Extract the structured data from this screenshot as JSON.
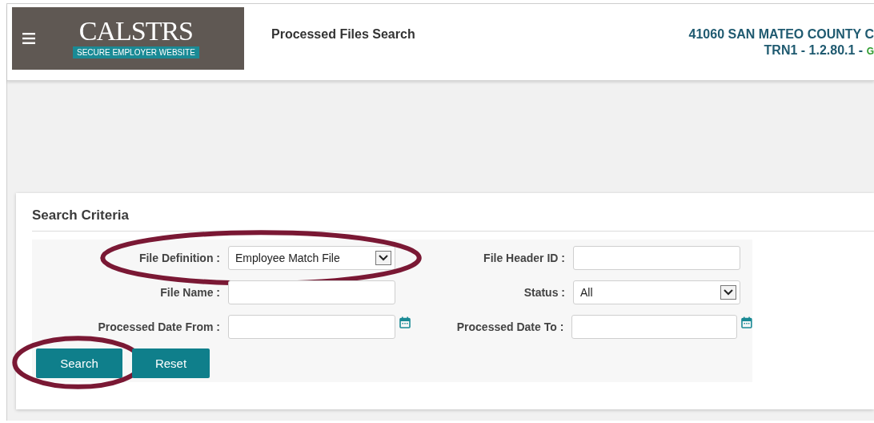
{
  "header": {
    "logo": {
      "name": "CALSTRS",
      "tagline": "SECURE EMPLOYER WEBSITE"
    },
    "page_title": "Processed Files Search",
    "employer": "41060 SAN MATEO COUNTY C",
    "environment": "TRN1 - 1.2.80.1 -",
    "status": "G"
  },
  "search_criteria": {
    "title": "Search Criteria",
    "fields": [
      {
        "label": "File Definition :",
        "kind": "select",
        "value": "Employee Match File",
        "highlighted": true
      },
      {
        "label": "File Header ID :",
        "kind": "text",
        "highlighted": false
      },
      {
        "label": "File Name :",
        "kind": "text",
        "highlighted": false
      },
      {
        "label": "Status :",
        "kind": "select",
        "value": "All",
        "highlighted": false
      },
      {
        "label": "Processed Date From :",
        "kind": "date",
        "highlighted": false
      },
      {
        "label": "Processed Date To :",
        "kind": "date",
        "highlighted": false
      }
    ],
    "buttons": [
      {
        "label": "Search",
        "highlighted": true
      },
      {
        "label": "Reset",
        "highlighted": false
      }
    ]
  }
}
